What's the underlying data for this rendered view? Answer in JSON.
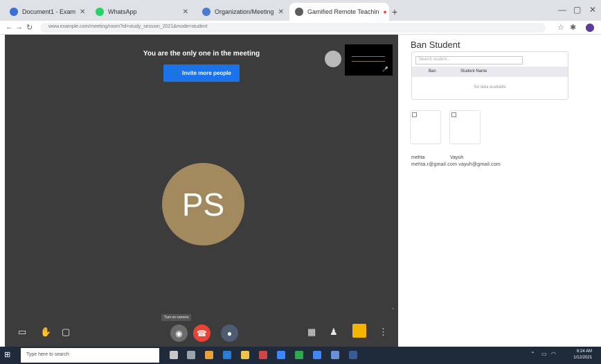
{
  "browser": {
    "tabs": [
      {
        "label": "Document1 - Exam",
        "color": "#3b6fd8",
        "active": false
      },
      {
        "label": "WhatsApp",
        "color": "#25d366",
        "active": false
      },
      {
        "label": "Organization/Meeting",
        "color": "#4a7bd0",
        "active": false
      },
      {
        "label": "Gamified Remote Teachin",
        "color": "#5c5c5c",
        "active": true
      }
    ],
    "new_tab": "+",
    "url": "www.example.com/meeting/room?id=study_session_2021&mode=student",
    "win_min": "—",
    "win_max": "▢",
    "win_close": "✕"
  },
  "meeting": {
    "title": "You are the only one in the meeting",
    "invite_label": "Invite more people",
    "avatar_initials": "PS",
    "tooltip": "Turn on camera",
    "colors": {
      "bg": "#3c3c3c",
      "accent": "#1a73e8",
      "hangup": "#ea4335",
      "avatar": "#a38a5e",
      "activities": "#f4b400"
    }
  },
  "panel": {
    "title": "Ban Student",
    "search_placeholder": "Search student...",
    "col_ban": "Ban",
    "col_name": "Student Name",
    "empty_text": "No data available",
    "names": [
      "mehta",
      "Vayuh"
    ],
    "emails": "mehta.r@gmail.com vayuh@gmail.com"
  },
  "taskbar": {
    "search_placeholder": "Type here to search",
    "time": "6:24 AM",
    "date": "1/12/2021"
  }
}
